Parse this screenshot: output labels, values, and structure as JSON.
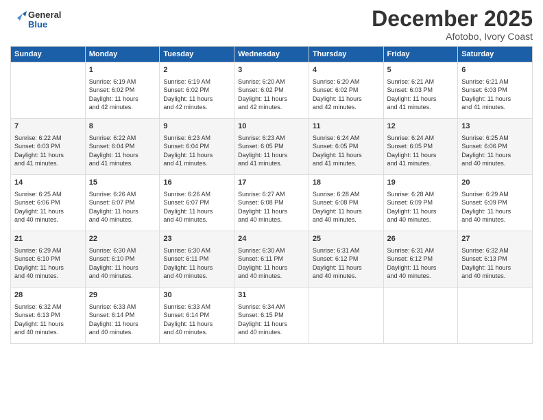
{
  "header": {
    "logo_line1": "General",
    "logo_line2": "Blue",
    "month": "December 2025",
    "location": "Afotobo, Ivory Coast"
  },
  "days_of_week": [
    "Sunday",
    "Monday",
    "Tuesday",
    "Wednesday",
    "Thursday",
    "Friday",
    "Saturday"
  ],
  "weeks": [
    [
      {
        "day": "",
        "info": ""
      },
      {
        "day": "1",
        "info": "Sunrise: 6:19 AM\nSunset: 6:02 PM\nDaylight: 11 hours\nand 42 minutes."
      },
      {
        "day": "2",
        "info": "Sunrise: 6:19 AM\nSunset: 6:02 PM\nDaylight: 11 hours\nand 42 minutes."
      },
      {
        "day": "3",
        "info": "Sunrise: 6:20 AM\nSunset: 6:02 PM\nDaylight: 11 hours\nand 42 minutes."
      },
      {
        "day": "4",
        "info": "Sunrise: 6:20 AM\nSunset: 6:02 PM\nDaylight: 11 hours\nand 42 minutes."
      },
      {
        "day": "5",
        "info": "Sunrise: 6:21 AM\nSunset: 6:03 PM\nDaylight: 11 hours\nand 41 minutes."
      },
      {
        "day": "6",
        "info": "Sunrise: 6:21 AM\nSunset: 6:03 PM\nDaylight: 11 hours\nand 41 minutes."
      }
    ],
    [
      {
        "day": "7",
        "info": "Sunrise: 6:22 AM\nSunset: 6:03 PM\nDaylight: 11 hours\nand 41 minutes."
      },
      {
        "day": "8",
        "info": "Sunrise: 6:22 AM\nSunset: 6:04 PM\nDaylight: 11 hours\nand 41 minutes."
      },
      {
        "day": "9",
        "info": "Sunrise: 6:23 AM\nSunset: 6:04 PM\nDaylight: 11 hours\nand 41 minutes."
      },
      {
        "day": "10",
        "info": "Sunrise: 6:23 AM\nSunset: 6:05 PM\nDaylight: 11 hours\nand 41 minutes."
      },
      {
        "day": "11",
        "info": "Sunrise: 6:24 AM\nSunset: 6:05 PM\nDaylight: 11 hours\nand 41 minutes."
      },
      {
        "day": "12",
        "info": "Sunrise: 6:24 AM\nSunset: 6:05 PM\nDaylight: 11 hours\nand 41 minutes."
      },
      {
        "day": "13",
        "info": "Sunrise: 6:25 AM\nSunset: 6:06 PM\nDaylight: 11 hours\nand 40 minutes."
      }
    ],
    [
      {
        "day": "14",
        "info": "Sunrise: 6:25 AM\nSunset: 6:06 PM\nDaylight: 11 hours\nand 40 minutes."
      },
      {
        "day": "15",
        "info": "Sunrise: 6:26 AM\nSunset: 6:07 PM\nDaylight: 11 hours\nand 40 minutes."
      },
      {
        "day": "16",
        "info": "Sunrise: 6:26 AM\nSunset: 6:07 PM\nDaylight: 11 hours\nand 40 minutes."
      },
      {
        "day": "17",
        "info": "Sunrise: 6:27 AM\nSunset: 6:08 PM\nDaylight: 11 hours\nand 40 minutes."
      },
      {
        "day": "18",
        "info": "Sunrise: 6:28 AM\nSunset: 6:08 PM\nDaylight: 11 hours\nand 40 minutes."
      },
      {
        "day": "19",
        "info": "Sunrise: 6:28 AM\nSunset: 6:09 PM\nDaylight: 11 hours\nand 40 minutes."
      },
      {
        "day": "20",
        "info": "Sunrise: 6:29 AM\nSunset: 6:09 PM\nDaylight: 11 hours\nand 40 minutes."
      }
    ],
    [
      {
        "day": "21",
        "info": "Sunrise: 6:29 AM\nSunset: 6:10 PM\nDaylight: 11 hours\nand 40 minutes."
      },
      {
        "day": "22",
        "info": "Sunrise: 6:30 AM\nSunset: 6:10 PM\nDaylight: 11 hours\nand 40 minutes."
      },
      {
        "day": "23",
        "info": "Sunrise: 6:30 AM\nSunset: 6:11 PM\nDaylight: 11 hours\nand 40 minutes."
      },
      {
        "day": "24",
        "info": "Sunrise: 6:30 AM\nSunset: 6:11 PM\nDaylight: 11 hours\nand 40 minutes."
      },
      {
        "day": "25",
        "info": "Sunrise: 6:31 AM\nSunset: 6:12 PM\nDaylight: 11 hours\nand 40 minutes."
      },
      {
        "day": "26",
        "info": "Sunrise: 6:31 AM\nSunset: 6:12 PM\nDaylight: 11 hours\nand 40 minutes."
      },
      {
        "day": "27",
        "info": "Sunrise: 6:32 AM\nSunset: 6:13 PM\nDaylight: 11 hours\nand 40 minutes."
      }
    ],
    [
      {
        "day": "28",
        "info": "Sunrise: 6:32 AM\nSunset: 6:13 PM\nDaylight: 11 hours\nand 40 minutes."
      },
      {
        "day": "29",
        "info": "Sunrise: 6:33 AM\nSunset: 6:14 PM\nDaylight: 11 hours\nand 40 minutes."
      },
      {
        "day": "30",
        "info": "Sunrise: 6:33 AM\nSunset: 6:14 PM\nDaylight: 11 hours\nand 40 minutes."
      },
      {
        "day": "31",
        "info": "Sunrise: 6:34 AM\nSunset: 6:15 PM\nDaylight: 11 hours\nand 40 minutes."
      },
      {
        "day": "",
        "info": ""
      },
      {
        "day": "",
        "info": ""
      },
      {
        "day": "",
        "info": ""
      }
    ]
  ]
}
